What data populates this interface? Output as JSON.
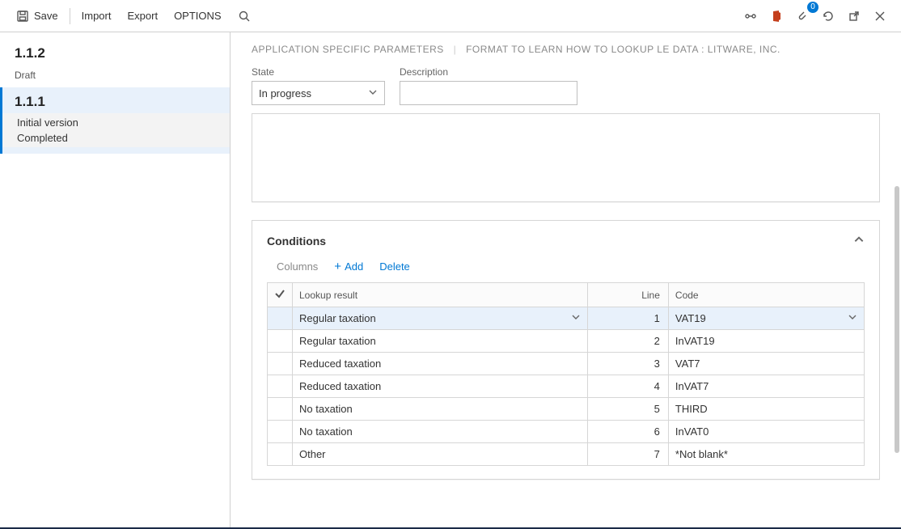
{
  "toolbar": {
    "save": "Save",
    "import": "Import",
    "export": "Export",
    "options": "OPTIONS",
    "badge_count": "0"
  },
  "sidebar": {
    "versions": [
      {
        "title": "1.1.2",
        "status": "Draft",
        "selected": false
      },
      {
        "title": "1.1.1",
        "status1": "Initial version",
        "status2": "Completed",
        "selected": true
      }
    ]
  },
  "breadcrumb": {
    "part1": "APPLICATION SPECIFIC PARAMETERS",
    "part2": "FORMAT TO LEARN HOW TO LOOKUP LE DATA : LITWARE, INC."
  },
  "fields": {
    "state_label": "State",
    "state_value": "In progress",
    "description_label": "Description",
    "description_value": ""
  },
  "conditions": {
    "title": "Conditions",
    "actions": {
      "columns": "Columns",
      "add": "Add",
      "delete": "Delete"
    },
    "columns": {
      "lookup": "Lookup result",
      "line": "Line",
      "code": "Code"
    },
    "rows": [
      {
        "lookup": "Regular taxation",
        "line": "1",
        "code": "VAT19",
        "selected": true
      },
      {
        "lookup": "Regular taxation",
        "line": "2",
        "code": "InVAT19",
        "selected": false
      },
      {
        "lookup": "Reduced taxation",
        "line": "3",
        "code": "VAT7",
        "selected": false
      },
      {
        "lookup": "Reduced taxation",
        "line": "4",
        "code": "InVAT7",
        "selected": false
      },
      {
        "lookup": "No taxation",
        "line": "5",
        "code": "THIRD",
        "selected": false
      },
      {
        "lookup": "No taxation",
        "line": "6",
        "code": "InVAT0",
        "selected": false
      },
      {
        "lookup": "Other",
        "line": "7",
        "code": "*Not blank*",
        "selected": false
      }
    ]
  }
}
